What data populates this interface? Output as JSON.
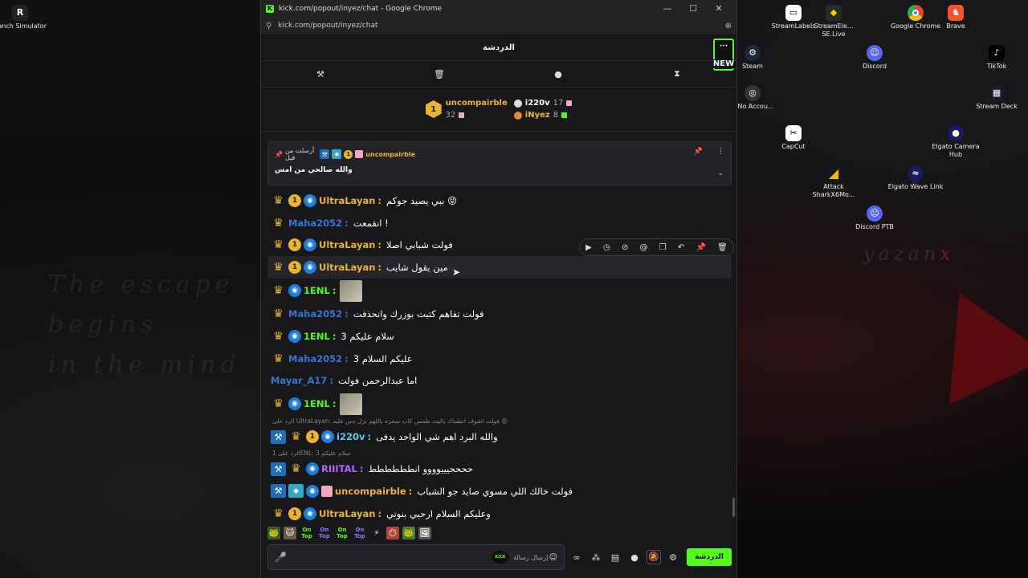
{
  "desktop": {
    "icons_left": [
      {
        "label": "Ranch Simulator",
        "icon": "ranch-simulator-icon"
      }
    ],
    "icons_right": [
      {
        "label": "StreamLabels",
        "icon": "streamlabels-icon",
        "color": "#ffffff"
      },
      {
        "label": "StreamEle... SE.Live",
        "icon": "streamelements-icon",
        "color": "#ffcc00"
      },
      {
        "label": "Google Chrome",
        "icon": "chrome-icon",
        "color": "#4285f4"
      },
      {
        "label": "Brave",
        "icon": "brave-icon",
        "color": "#fb542b"
      },
      {
        "label": "Steam",
        "icon": "steam-icon",
        "color": "#1b2838"
      },
      {
        "label": "Discord",
        "icon": "discord-icon",
        "color": "#5865f2"
      },
      {
        "label": "TikTok",
        "icon": "tiktok-icon",
        "color": "#000000"
      },
      {
        "label": "TcNo Accou...",
        "icon": "tcno-icon",
        "color": "#333333"
      },
      {
        "label": "Stream Deck",
        "icon": "streamdeck-icon",
        "color": "#000000"
      },
      {
        "label": "CapCut",
        "icon": "capcut-icon",
        "color": "#000000"
      },
      {
        "label": "Elgato Camera Hub",
        "icon": "elgato-camera-icon",
        "color": "#1a1a5e"
      },
      {
        "label": "Attack SharkX6Mo...",
        "icon": "attack-shark-icon",
        "color": "#f5b800"
      },
      {
        "label": "Elgato Wave Link",
        "icon": "elgato-wave-icon",
        "color": "#1a1a5e"
      },
      {
        "label": "Discord PTB",
        "icon": "discord-ptb-icon",
        "color": "#5865f2"
      }
    ],
    "wallpaper_lines": [
      "The escape",
      "begins",
      "in the mind"
    ],
    "wallpaper_signature": "yazan",
    "wallpaper_signature_mark": "x"
  },
  "browser": {
    "window_title": "kick.com/popout/inyez/chat - Google Chrome",
    "url": "kick.com/popout/inyez/chat",
    "minimize": "—",
    "maximize": "☐",
    "close": "✕"
  },
  "chat": {
    "header_title": "الدردشة",
    "more_label": "···",
    "new_label": "NEW",
    "toolbar": [
      "hammer-icon",
      "trash-icon",
      "chat-bubble-icon",
      "hourglass-icon"
    ],
    "leaderboard": {
      "first": {
        "rank": "1",
        "name": "uncompairble",
        "count": "32",
        "name_color": "#e9b530"
      },
      "second": {
        "name": "i220v",
        "count": "17",
        "name_color": "#ffffff"
      },
      "third": {
        "name": "iNyez",
        "count": "8",
        "name_color": "#e9b530"
      }
    },
    "pinned": {
      "pinned_by": "أرسلت من قبل",
      "user": "uncompairble",
      "user_color": "#e9b530",
      "message": "والله صالحي من امس"
    },
    "messages": [
      {
        "user": "UltraLayan",
        "color": "#e9b530",
        "badges": [
          "crown",
          "one",
          "eye"
        ],
        "text": "ببي يصيد جوكم 😝"
      },
      {
        "user": "Maha2052",
        "color": "#3b73d6",
        "badges": [
          "crown"
        ],
        "text": "انقمعت !"
      },
      {
        "user": "UltraLayan",
        "color": "#e9b530",
        "badges": [
          "crown",
          "one",
          "eye"
        ],
        "text": "فولت شبابي اصلا"
      },
      {
        "user": "UltraLayan",
        "color": "#e9b530",
        "badges": [
          "crown",
          "one",
          "eye"
        ],
        "text": "مين يقول شايب",
        "highlight": true
      },
      {
        "user": "1ENL",
        "color": "#53fc18",
        "badges": [
          "crown",
          "eye"
        ],
        "text": "",
        "emote": true
      },
      {
        "user": "Maha2052",
        "color": "#3b73d6",
        "badges": [
          "crown"
        ],
        "text": "فولت تفاهم كتبت بوزرك وانحذفت"
      },
      {
        "user": "1ENL",
        "color": "#53fc18",
        "badges": [
          "crown",
          "eye"
        ],
        "text": "سلام عليكم 3"
      },
      {
        "user": "Maha2052",
        "color": "#3b73d6",
        "badges": [
          "crown"
        ],
        "text": "عليكم السلام 3"
      },
      {
        "user": "Mayar_A17",
        "color": "#3b73d6",
        "badges": [],
        "text": "اما عبدالرحمن فولت"
      },
      {
        "user": "1ENL",
        "color": "#53fc18",
        "badges": [
          "crown",
          "eye"
        ],
        "text": "",
        "emote": true
      },
      {
        "reply": "الرد على UltraLayan: فولت اشوف انطماك ياليت طمس كاب سحره باللهم نزل دس عليه 😝"
      },
      {
        "user": "i220v",
        "color": "#5cc8f0",
        "badges": [
          "mod",
          "crown",
          "one",
          "eye"
        ],
        "text": "والله البرد اهم شي الواحد يدفى"
      },
      {
        "reply": "الرد على 1ENL: سلام عليكم 3"
      },
      {
        "user": "RIIITAL",
        "color": "#b463ff",
        "badges": [
          "mod",
          "crown",
          "eye"
        ],
        "text": "ححححيييوووو انطططططط"
      },
      {
        "user": "uncompairble",
        "color": "#e9b530",
        "badges": [
          "mod",
          "vip",
          "eye",
          "gift"
        ],
        "text": "فولت خالك اللي مسوي صايد جو الشباب"
      },
      {
        "user": "UltraLayan",
        "color": "#e9b530",
        "badges": [
          "crown",
          "one",
          "eye"
        ],
        "text": "وعليكم السلام ارحبي بنوتي"
      }
    ],
    "message_actions": [
      "play-icon",
      "clock-icon",
      "eye-off-icon",
      "mention-icon",
      "copy-icon",
      "reply-icon",
      "pin-icon",
      "delete-icon"
    ],
    "emote_bar": [
      {
        "type": "icon",
        "name": "pepe-emote",
        "glyph": "🐸"
      },
      {
        "type": "icon",
        "name": "cat-emote",
        "glyph": "🐱"
      },
      {
        "type": "text",
        "name": "on-top-emote",
        "l1": "On",
        "l2": "Top"
      },
      {
        "type": "text",
        "name": "on-top-emote",
        "l1": "On",
        "l2": "Top"
      },
      {
        "type": "text",
        "name": "on-top-emote",
        "l1": "On",
        "l2": "Top"
      },
      {
        "type": "text",
        "name": "on-top-emote",
        "l1": "On",
        "l2": "Top"
      },
      {
        "type": "icon",
        "name": "bolt-emote",
        "glyph": "⚡"
      },
      {
        "type": "icon",
        "name": "face-emote",
        "glyph": "😶"
      },
      {
        "type": "icon",
        "name": "frog-emote",
        "glyph": "🐸"
      },
      {
        "type": "icon",
        "name": "meme-emote",
        "glyph": "🖼"
      }
    ],
    "input": {
      "placeholder": "إرسال رسالة",
      "kick_chip": "KICK",
      "emoji": "☺",
      "mic": "🎤"
    },
    "bottom_icons": [
      "infinity-icon",
      "people-icon",
      "store-icon",
      "chat-icon",
      "bell-off-icon",
      "settings-icon"
    ],
    "send_label": "الدردشة"
  }
}
